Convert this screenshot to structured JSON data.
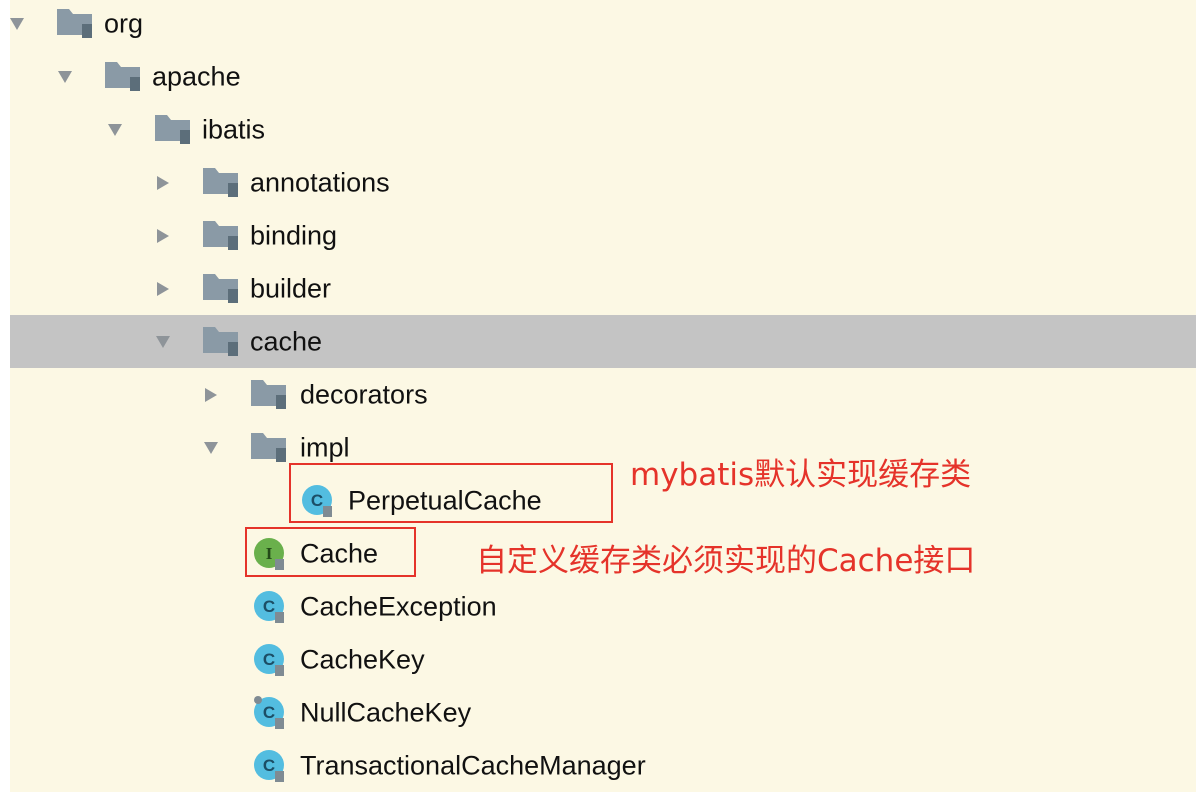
{
  "tree": {
    "items": [
      {
        "label": "org",
        "icon": "folder-icon",
        "expanded": true
      },
      {
        "label": "apache",
        "icon": "folder-icon",
        "expanded": true
      },
      {
        "label": "ibatis",
        "icon": "folder-icon",
        "expanded": true
      },
      {
        "label": "annotations",
        "icon": "folder-icon",
        "expanded": false
      },
      {
        "label": "binding",
        "icon": "folder-icon",
        "expanded": false
      },
      {
        "label": "builder",
        "icon": "folder-icon",
        "expanded": false
      },
      {
        "label": "cache",
        "icon": "folder-icon",
        "expanded": true,
        "selected": true
      },
      {
        "label": "decorators",
        "icon": "folder-icon",
        "expanded": false
      },
      {
        "label": "impl",
        "icon": "folder-icon",
        "expanded": true
      },
      {
        "label": "PerpetualCache",
        "icon": "class-icon",
        "badge": "C"
      },
      {
        "label": "Cache",
        "icon": "interface-icon",
        "badge": "I"
      },
      {
        "label": "CacheException",
        "icon": "class-icon",
        "badge": "C"
      },
      {
        "label": "CacheKey",
        "icon": "class-icon",
        "badge": "C"
      },
      {
        "label": "NullCacheKey",
        "icon": "class-icon",
        "badge": "C"
      },
      {
        "label": "TransactionalCacheManager",
        "icon": "class-icon",
        "badge": "C"
      }
    ]
  },
  "annotations": {
    "perpetual_cache_note": "mybatis默认实现缓存类",
    "cache_interface_note": "自定义缓存类必须实现的Cache接口"
  },
  "colors": {
    "panel_background": "#fcf8e4",
    "selected_row": "#c4c4c4",
    "annotation_red": "#e5332a",
    "class_icon": "#53bde0",
    "interface_icon": "#6ab04c",
    "folder": "#8a9aa6"
  }
}
